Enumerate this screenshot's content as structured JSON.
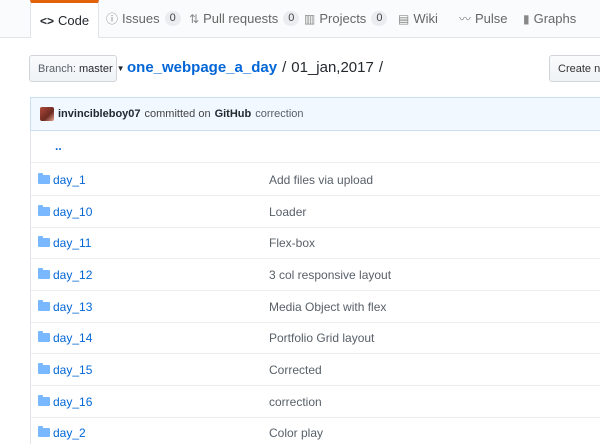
{
  "tabs": [
    {
      "icon": "<>",
      "label": "Code",
      "count": null
    },
    {
      "icon": "ⓘ",
      "label": "Issues",
      "count": "0"
    },
    {
      "icon": "⇅",
      "label": "Pull requests",
      "count": "0"
    },
    {
      "icon": "▥",
      "label": "Projects",
      "count": "0"
    },
    {
      "icon": "▤",
      "label": "Wiki",
      "count": null
    },
    {
      "icon": "〰",
      "label": "Pulse",
      "count": null
    },
    {
      "icon": "▮",
      "label": "Graphs",
      "count": null
    }
  ],
  "branch": {
    "prefix": "Branch:",
    "name": "master"
  },
  "breadcrumb": {
    "repo": "one_webpage_a_day",
    "sep": "/",
    "folder": "01_jan,2017",
    "trail": "/"
  },
  "create_button": "Create new file",
  "commit": {
    "author": "invincibleboy07",
    "verb": "committed on",
    "committer": "GitHub",
    "message": "correction"
  },
  "up_link": "..",
  "files": [
    {
      "name": "day_1",
      "message": "Add files via upload"
    },
    {
      "name": "day_10",
      "message": "Loader"
    },
    {
      "name": "day_11",
      "message": "Flex-box"
    },
    {
      "name": "day_12",
      "message": "3 col responsive layout"
    },
    {
      "name": "day_13",
      "message": "Media Object with flex"
    },
    {
      "name": "day_14",
      "message": "Portfolio Grid layout"
    },
    {
      "name": "day_15",
      "message": "Corrected"
    },
    {
      "name": "day_16",
      "message": "correction"
    },
    {
      "name": "day_2",
      "message": "Color play"
    }
  ]
}
